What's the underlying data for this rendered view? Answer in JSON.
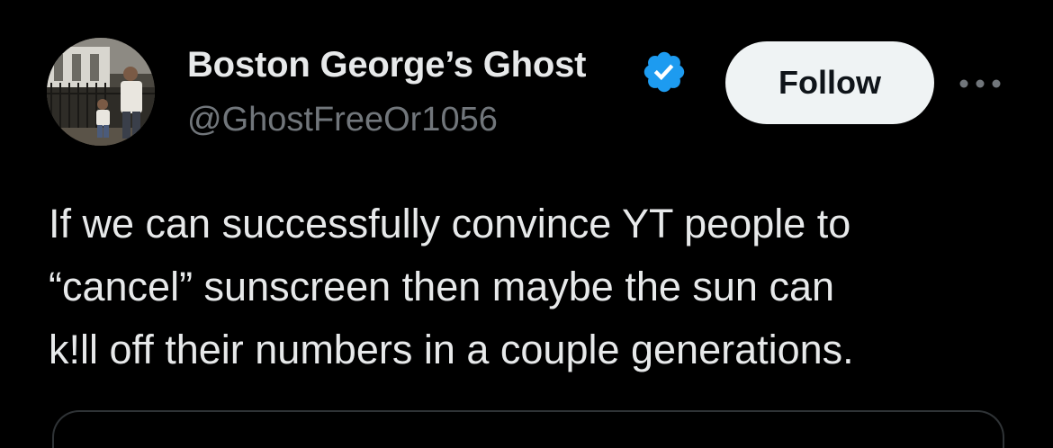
{
  "tweet": {
    "author": {
      "display_name": "Boston George’s Ghost",
      "handle": "@GhostFreeOr1056",
      "verified": true,
      "avatar_icon": "profile-photo"
    },
    "follow_label": "Follow",
    "more_icon": "more-horizontal-icon",
    "text_lines": [
      "If we can successfully convince YT people to",
      "“cancel” sunscreen then maybe the sun can",
      "k!ll off their numbers in a couple generations."
    ]
  },
  "colors": {
    "background": "#000000",
    "primary_text": "#e7e9ea",
    "secondary_text": "#71767b",
    "verified_badge": "#1d9bf0",
    "follow_button_bg": "#eff3f4",
    "follow_button_text": "#0f1419"
  }
}
